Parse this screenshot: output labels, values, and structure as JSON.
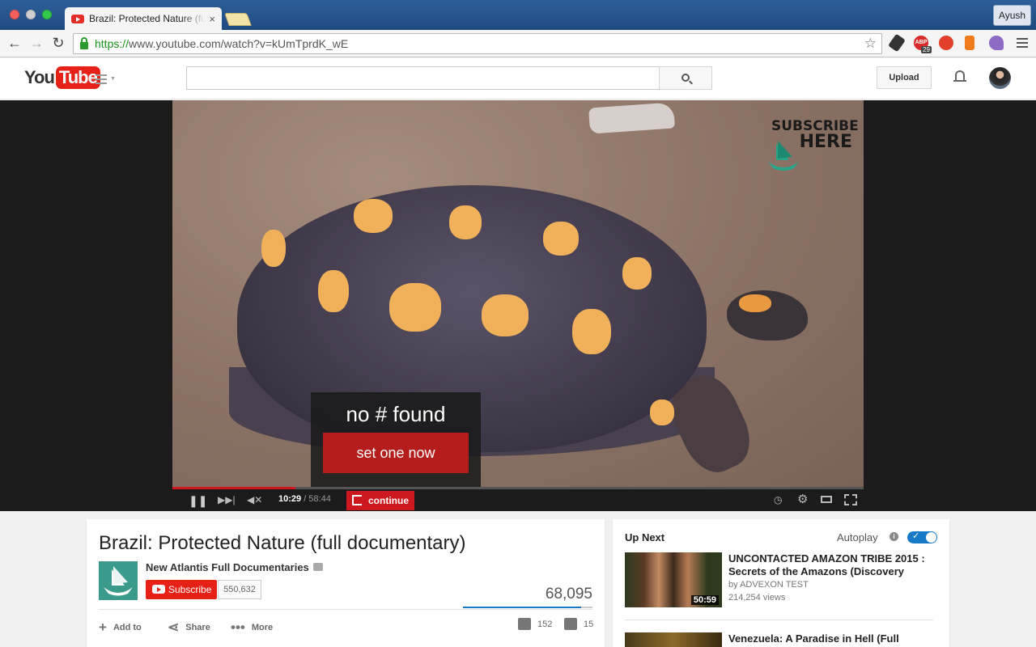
{
  "browser": {
    "tab_title": "Brazil: Protected Nature (full documentary) - YouTube",
    "tab_close": "×",
    "profile_name": "Ayush",
    "url_scheme": "https://",
    "url_rest": "www.youtube.com/watch?v=kUmTprdK_wE",
    "abp_count": "29"
  },
  "header": {
    "logo_you": "You",
    "logo_tube": "Tube",
    "search_placeholder": "",
    "upload_label": "Upload"
  },
  "player": {
    "watermark_line1": "SUBSCRIBE",
    "watermark_line2": "HERE",
    "overlay_title": "no # found",
    "overlay_button": "set one now",
    "time_current": "10:29",
    "time_total": " / 58:44",
    "continue_label": "continue",
    "progress_fraction": 0.178
  },
  "video": {
    "title": "Brazil: Protected Nature (full documentary)",
    "channel_name": "New Atlantis Full Documentaries",
    "subscribe_label": "Subscribe",
    "subscriber_count": "550,632",
    "view_count": "68,095",
    "like_fraction": 0.91,
    "actions": {
      "add_to": "Add to",
      "share": "Share",
      "more": "More"
    },
    "likes": "152",
    "dislikes": "15"
  },
  "sidebar": {
    "up_next_label": "Up Next",
    "autoplay_label": "Autoplay",
    "autoplay_on": true,
    "recommendations": [
      {
        "title": "UNCONTACTED AMAZON TRIBE 2015 : Secrets of the Amazons (Discovery",
        "channel": "by ADVEXON TEST",
        "views": "214,254 views",
        "duration": "50:59"
      },
      {
        "title": "Venezuela: A Paradise in Hell (Full"
      }
    ]
  },
  "colors": {
    "youtube_red": "#e62117",
    "progress_red": "#cc181e",
    "autoplay_blue": "#167ac6"
  }
}
